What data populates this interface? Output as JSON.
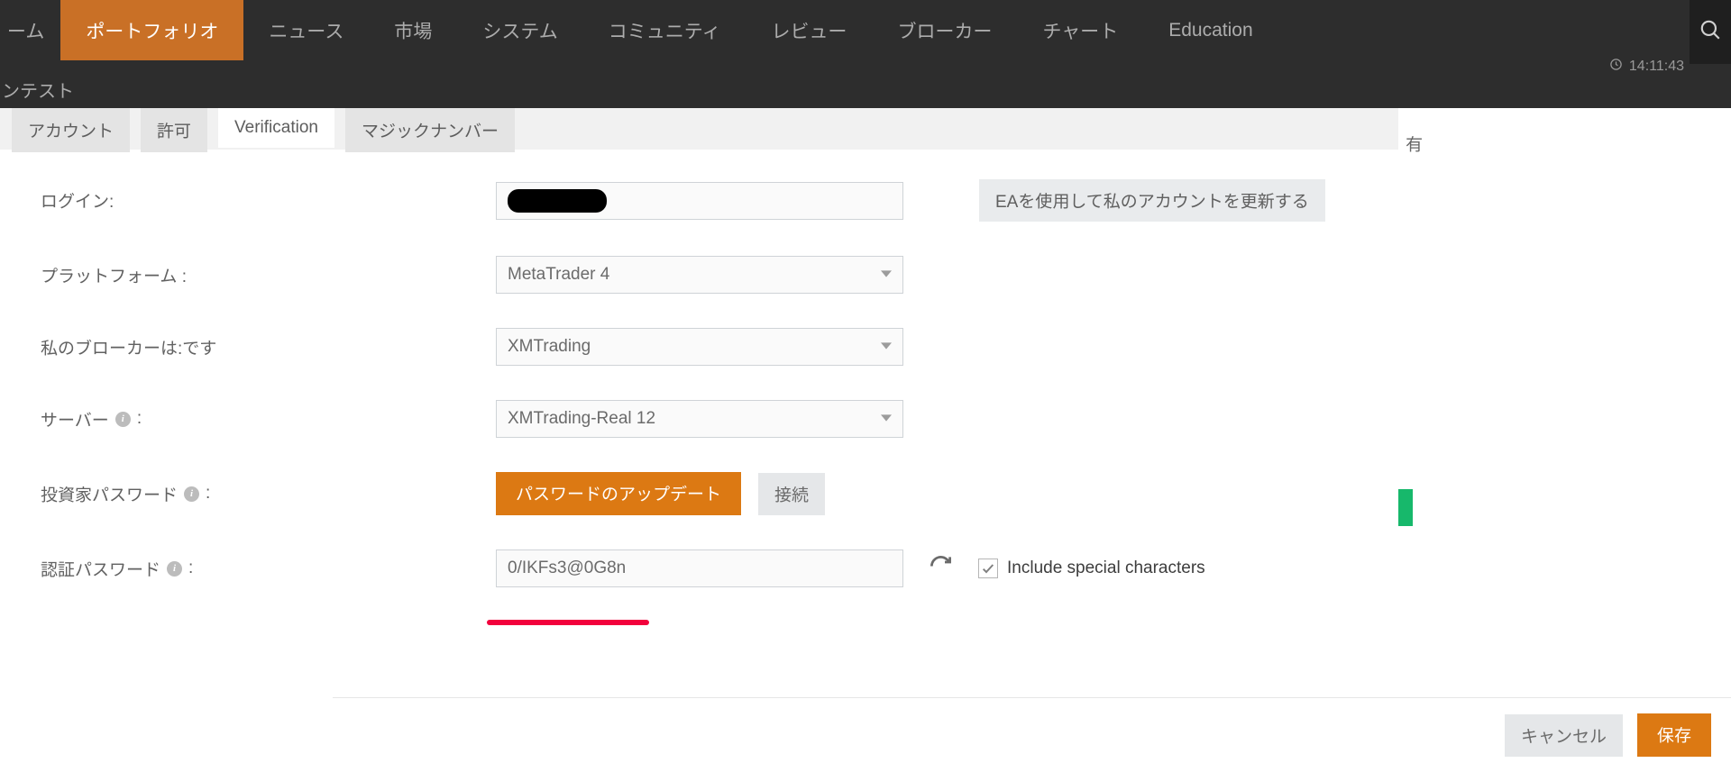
{
  "nav": {
    "items": [
      {
        "label": "ーム"
      },
      {
        "label": "ポートフォリオ"
      },
      {
        "label": "ニュース"
      },
      {
        "label": "市場"
      },
      {
        "label": "システム"
      },
      {
        "label": "コミュニティ"
      },
      {
        "label": "レビュー"
      },
      {
        "label": "ブローカー"
      },
      {
        "label": "チャート"
      },
      {
        "label": "Education"
      }
    ],
    "clock": "14:11:43",
    "subbar": "ンテスト"
  },
  "tabs": [
    {
      "label": "アカウント"
    },
    {
      "label": "許可"
    },
    {
      "label": "Verification"
    },
    {
      "label": "マジックナンバー"
    }
  ],
  "edge_label": "有",
  "form": {
    "login": {
      "label": "ログイン:",
      "value": ""
    },
    "platform": {
      "label": "プラットフォーム :",
      "value": "MetaTrader 4"
    },
    "broker": {
      "label": "私のブローカーは:です",
      "value": "XMTrading"
    },
    "server": {
      "label": "サーバー",
      "value": "XMTrading-Real 12"
    },
    "investor_password": {
      "label": "投資家パスワード",
      "update_btn": "パスワードのアップデート",
      "connect_btn": "接続"
    },
    "verify_password": {
      "label": "認証パスワード",
      "value": "0/IKFs3@0G8n",
      "checkbox_label": "Include special characters"
    }
  },
  "side_button": "EAを使用して私のアカウントを更新する",
  "footer": {
    "cancel": "キャンセル",
    "save": "保存"
  }
}
